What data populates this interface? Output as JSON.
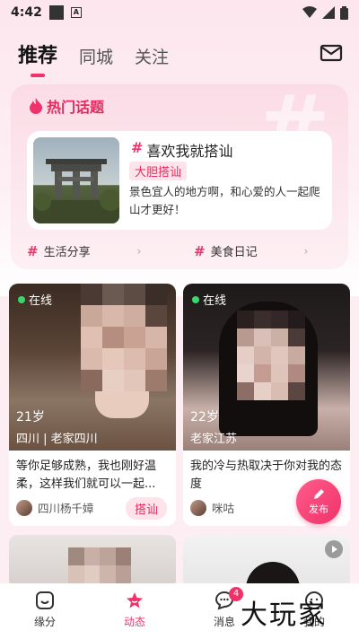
{
  "status_bar": {
    "time": "4:42"
  },
  "tabs": [
    {
      "label": "推荐"
    },
    {
      "label": "同城"
    },
    {
      "label": "关注"
    }
  ],
  "hot_topics": {
    "title": "热门话题",
    "featured": {
      "name": "喜欢我就搭讪",
      "tag": "大胆搭讪",
      "desc": "景色宜人的地方啊，和心爱的人一起爬山才更好！"
    },
    "sub_topics": [
      {
        "label": "生活分享"
      },
      {
        "label": "美食日记"
      }
    ]
  },
  "feed": [
    {
      "online": "在线",
      "age": "21岁",
      "location": "四川 | 老家四川",
      "caption": "等你足够成熟，我也刚好温柔，这样我们就可以一起...",
      "poster": "四川杨千嫜",
      "action": "搭讪"
    },
    {
      "online": "在线",
      "age": "22岁",
      "location": "老家江苏",
      "caption": "我的冷与热取决于你对我的态度",
      "poster": "咪咕"
    }
  ],
  "publish": {
    "label": "发布"
  },
  "bottom_nav": [
    {
      "label": "缘分",
      "icon": "face-icon"
    },
    {
      "label": "动态",
      "icon": "star-icon"
    },
    {
      "label": "消息",
      "icon": "chat-icon",
      "badge": "4"
    },
    {
      "label": "我的",
      "icon": "profile-icon"
    }
  ],
  "watermark": "大玩家",
  "colors": {
    "accent": "#f0326a",
    "background": "#fdeef3"
  }
}
